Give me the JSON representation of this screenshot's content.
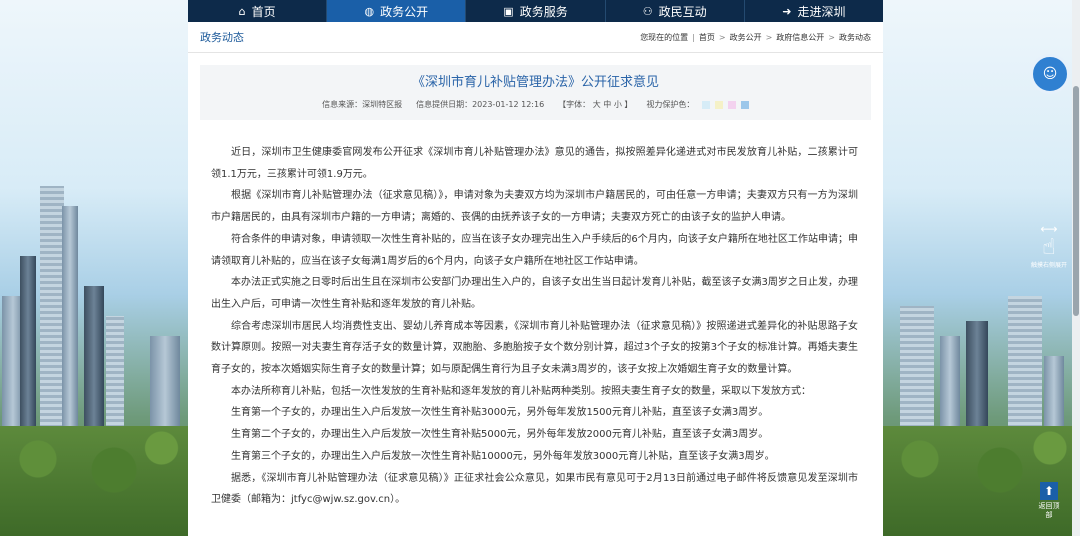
{
  "nav": {
    "items": [
      {
        "label": "首页",
        "icon": "home-icon",
        "glyph": "⌂",
        "active": false
      },
      {
        "label": "政务公开",
        "icon": "globe-icon",
        "glyph": "◍",
        "active": true
      },
      {
        "label": "政务服务",
        "icon": "monitor-icon",
        "glyph": "▣",
        "active": false
      },
      {
        "label": "政民互动",
        "icon": "people-icon",
        "glyph": "⚇",
        "active": false
      },
      {
        "label": "走进深圳",
        "icon": "arrow-circle-icon",
        "glyph": "➜",
        "active": false
      }
    ]
  },
  "section_title": "政务动态",
  "breadcrumb": {
    "prefix": "您现在的位置",
    "items": [
      "首页",
      "政务公开",
      "政府信息公开",
      "政务动态"
    ],
    "separator": ">"
  },
  "article": {
    "title": "《深圳市育儿补贴管理办法》公开征求意见",
    "source_label": "信息来源：深圳特区报",
    "date_label": "信息提供日期：2023-01-12 12:16",
    "font_label": "【字体：",
    "font_sizes": [
      "大",
      "中",
      "小"
    ],
    "font_close": "】",
    "eye_label": "视力保护色：",
    "eye_colors": [
      "#d6ecf7",
      "#f5f1c7",
      "#f3d2ef",
      "#9cc7ea"
    ],
    "paragraphs": [
      "近日，深圳市卫生健康委官网发布公开征求《深圳市育儿补贴管理办法》意见的通告，拟按照差异化递进式对市民发放育儿补贴，二孩累计可领1.1万元，三孩累计可领1.9万元。",
      "根据《深圳市育儿补贴管理办法（征求意见稿）》，申请对象为夫妻双方均为深圳市户籍居民的，可由任意一方申请；夫妻双方只有一方为深圳市户籍居民的，由具有深圳市户籍的一方申请；离婚的、丧偶的由抚养该子女的一方申请；夫妻双方死亡的由该子女的监护人申请。",
      "符合条件的申请对象，申请领取一次性生育补贴的，应当在该子女办理完出生入户手续后的6个月内，向该子女户籍所在地社区工作站申请；申请领取育儿补贴的，应当在该子女每满1周岁后的6个月内，向该子女户籍所在地社区工作站申请。",
      "本办法正式实施之日零时后出生且在深圳市公安部门办理出生入户的，自该子女出生当日起计发育儿补贴，截至该子女满3周岁之日止发，办理出生入户后，可申请一次性生育补贴和逐年发放的育儿补贴。",
      "综合考虑深圳市居民人均消费性支出、婴幼儿养育成本等因素，《深圳市育儿补贴管理办法（征求意见稿）》按照递进式差异化的补贴思路子女数计算原则。按照一对夫妻生育存活子女的数量计算，双胞胎、多胞胎按子女个数分别计算，超过3个子女的按第3个子女的标准计算。再婚夫妻生育子女的，按本次婚姻实际生育子女的数量计算；如与原配偶生育行为且子女未满3周岁的，该子女按上次婚姻生育子女的数量计算。",
      "本办法所称育儿补贴，包括一次性发放的生育补贴和逐年发放的育儿补贴两种类别。按照夫妻生育子女的数量，采取以下发放方式：",
      "生育第一个子女的，办理出生入户后发放一次性生育补贴3000元，另外每年发放1500元育儿补贴，直至该子女满3周岁。",
      "生育第二个子女的，办理出生入户后发放一次性生育补贴5000元，另外每年发放2000元育儿补贴，直至该子女满3周岁。",
      "生育第三个子女的，办理出生入户后发放一次性生育补贴10000元，另外每年发放3000元育儿补贴，直至该子女满3周岁。",
      "据悉，《深圳市育儿补贴管理办法（征求意见稿）》正征求社会公众意见，如果市民有意见可于2月13日前通过电子邮件将反馈意见发至深圳市卫健委（邮箱为：jtfyc@wjw.sz.gov.cn）。"
    ]
  },
  "widgets": {
    "swipe_label": "触摸右侧展开",
    "backtop_label": "返回顶部"
  }
}
